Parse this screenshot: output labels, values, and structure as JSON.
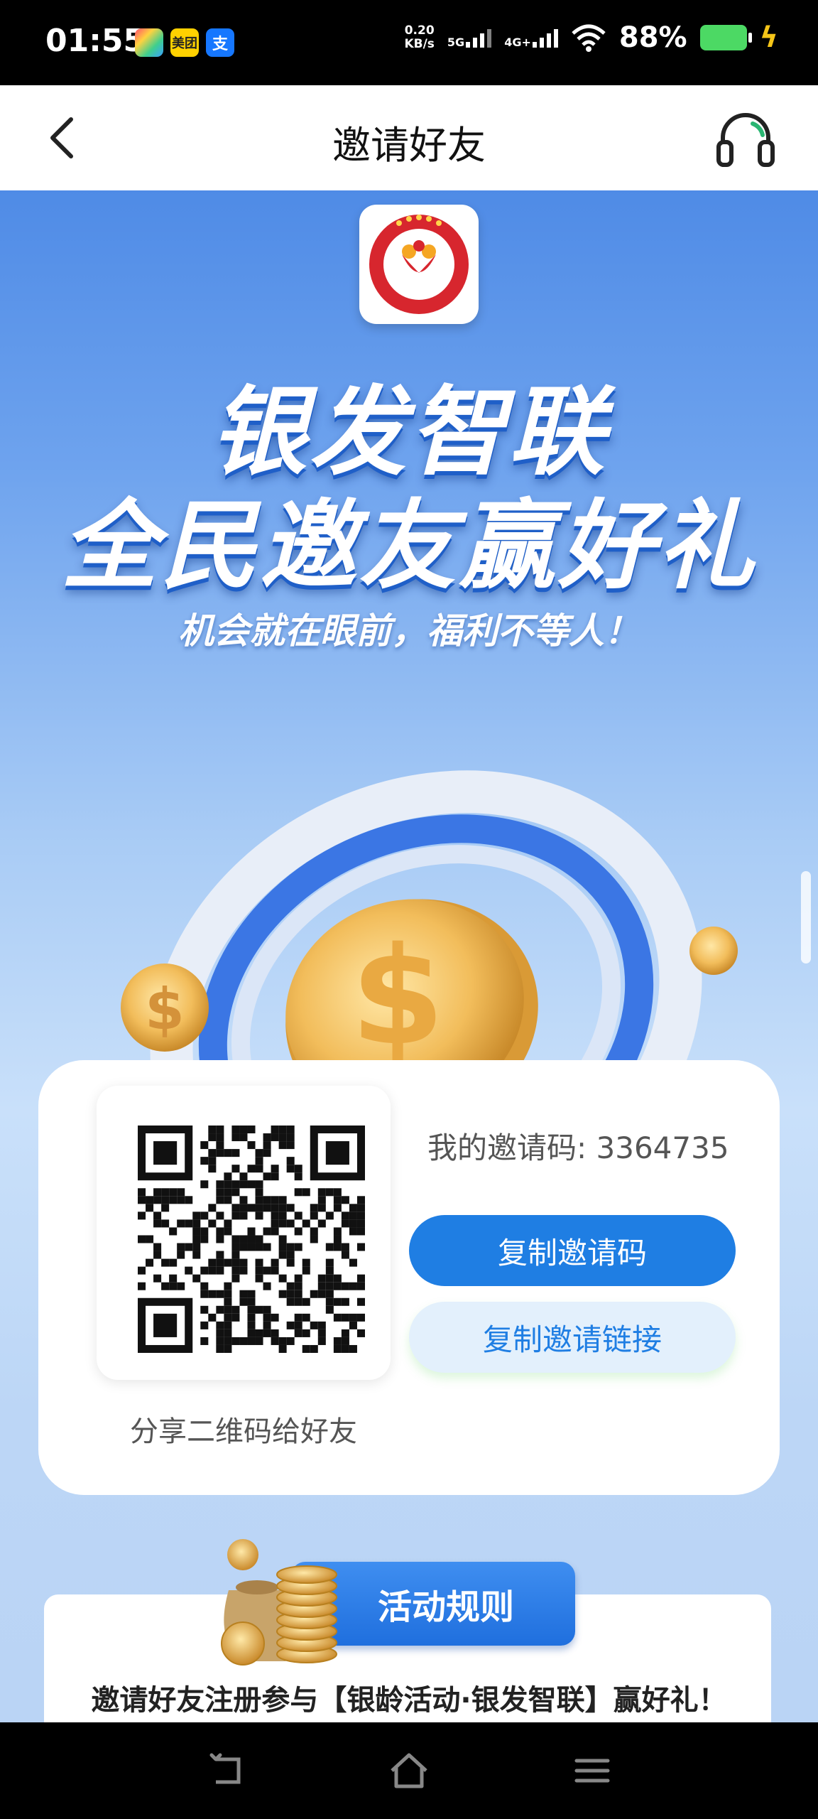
{
  "status_bar": {
    "time": "01:55",
    "apps": [
      {
        "label": "",
        "icon": "app-store-icon"
      },
      {
        "label": "美团",
        "icon": "meituan-icon"
      },
      {
        "label": "支",
        "icon": "alipay-icon"
      }
    ],
    "speed_value": "0.20",
    "speed_unit": "KB/s",
    "net1": "5G",
    "net2": "4G+",
    "battery": "88%"
  },
  "header": {
    "title": "邀请好友"
  },
  "banner": {
    "line1": "银发智联",
    "line2": "全民邀友赢好礼",
    "subtitle": "机会就在眼前，福利不等人！"
  },
  "invite": {
    "code_text": "我的邀请码: 3364735",
    "qr_caption": "分享二维码给好友",
    "copy_code_label": "复制邀请码",
    "copy_link_label": "复制邀请链接"
  },
  "rules": {
    "title": "活动规则",
    "text": "邀请好友注册参与【银龄活动·银发智联】赢好礼！"
  },
  "colors": {
    "primary": "#1f7ee3",
    "primary_light": "#e3f0fc",
    "banner_blue": "#4f8be6"
  }
}
